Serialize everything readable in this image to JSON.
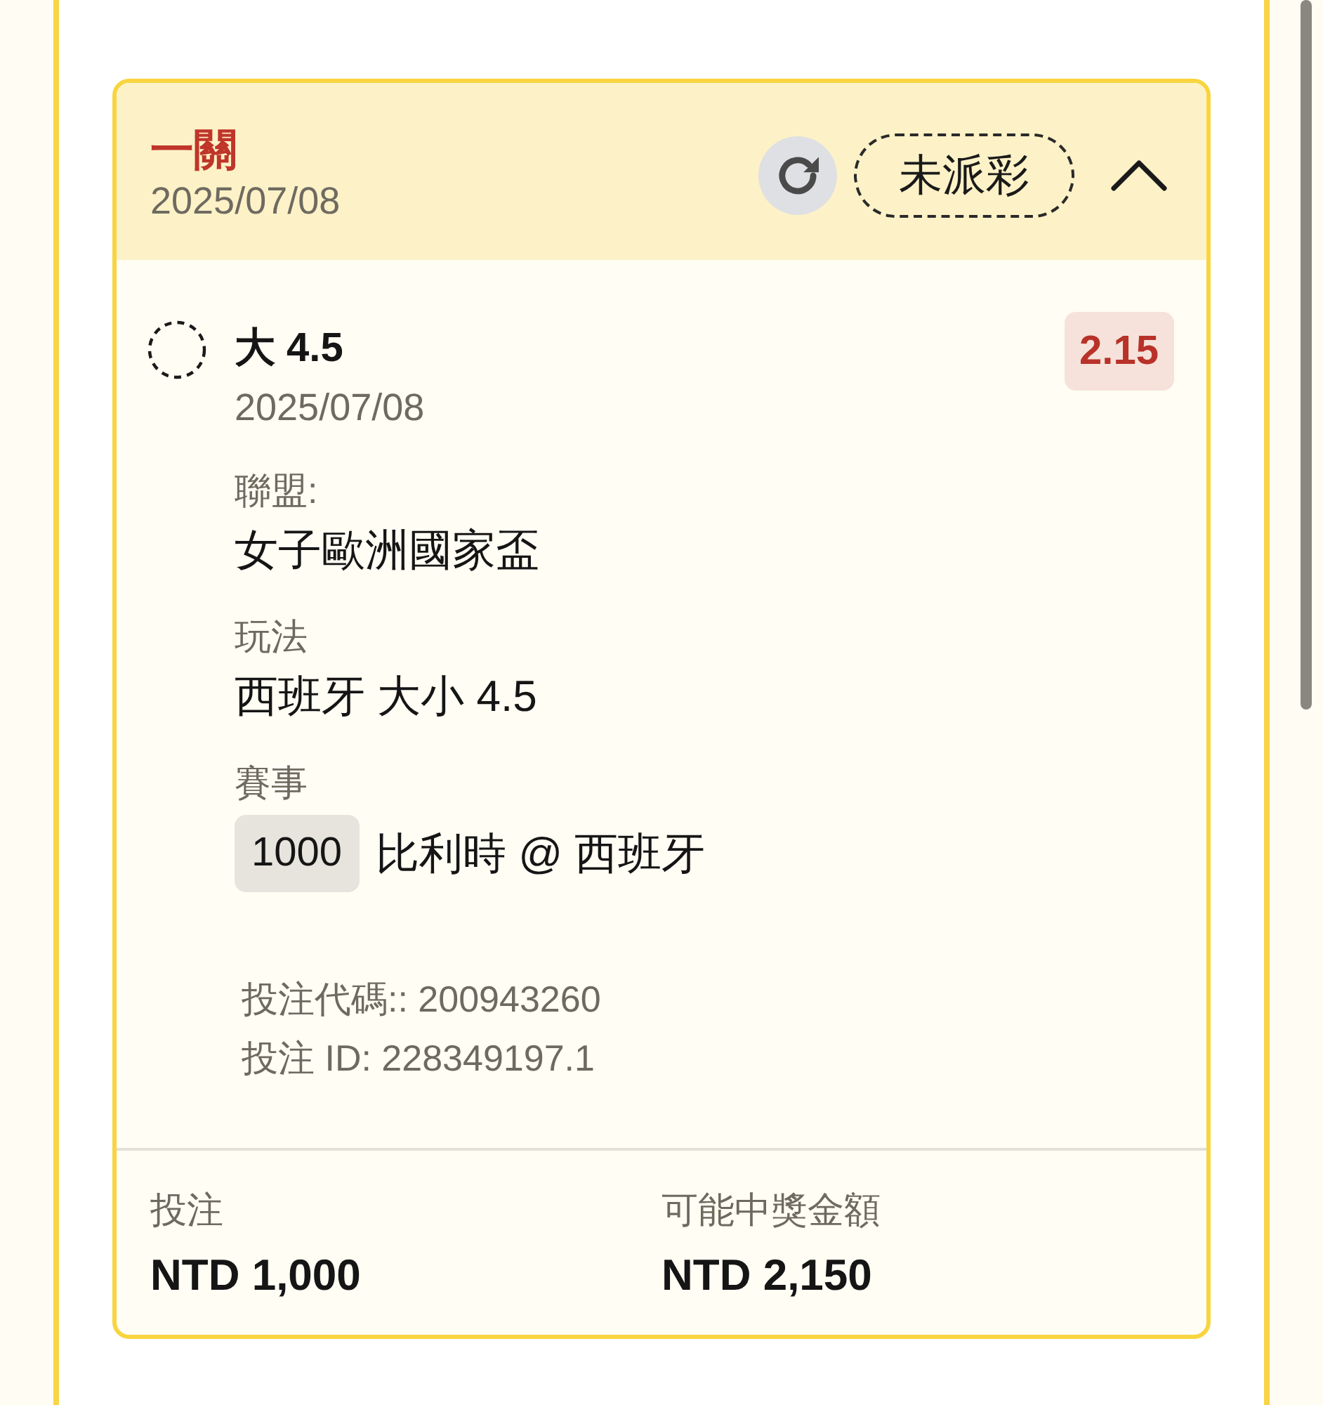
{
  "bet_card": {
    "title": "一關",
    "date": "2025/07/08",
    "status": "未派彩",
    "expanded": true,
    "selection": {
      "name": "大 4.5",
      "date": "2025/07/08",
      "odds": "2.15"
    },
    "details": [
      {
        "kind": "text",
        "label": "聯盟:",
        "value": "女子歐洲國家盃"
      },
      {
        "kind": "text",
        "label": "玩法",
        "value": "西班牙 大小 4.5"
      },
      {
        "kind": "match",
        "label": "賽事",
        "code": "1000",
        "value": "比利時 @ 西班牙"
      }
    ],
    "references": [
      "投注代碼:: 200943260",
      "投注 ID: 228349197.1"
    ],
    "summary": [
      {
        "label": "投注",
        "amount": "NTD 1,000"
      },
      {
        "label": "可能中獎金額",
        "amount": "NTD 2,150"
      }
    ]
  }
}
